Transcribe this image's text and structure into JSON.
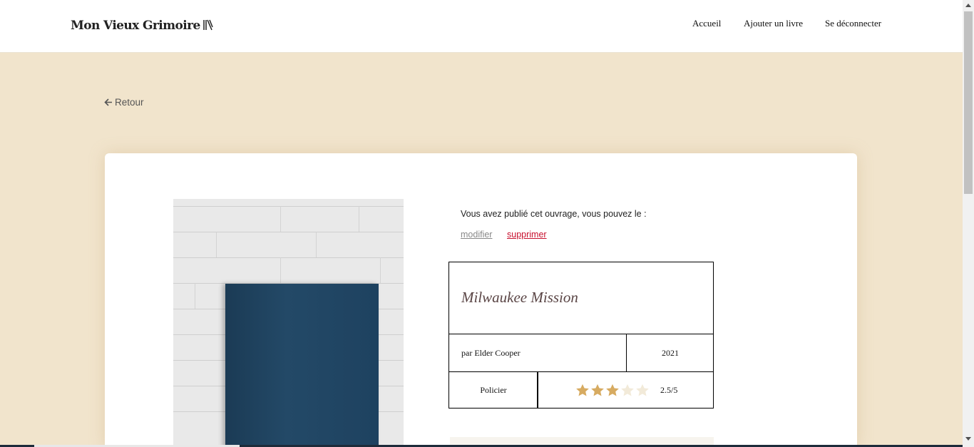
{
  "header": {
    "logo": "Mon Vieux Grimoire",
    "nav": [
      "Accueil",
      "Ajouter un livre",
      "Se déconnecter"
    ]
  },
  "back_label": "Retour",
  "owner_notice": "Vous avez publié cet ouvrage, vous pouvez le :",
  "actions": {
    "edit": "modifier",
    "delete": "supprimer"
  },
  "book": {
    "title": "Milwaukee Mission",
    "author": "par Elder Cooper",
    "year": "2021",
    "genre": "Policier",
    "rating": 2.5,
    "rating_max": 5,
    "rating_label": "2.5/5"
  },
  "colors": {
    "accent_star": "#d7ab61",
    "star_empty": "#f2ead9",
    "delete_red": "#c8102e",
    "background": "#f1e4cc"
  },
  "icons": [
    "arrow-left-icon",
    "star-icon",
    "book-logo-icon"
  ]
}
